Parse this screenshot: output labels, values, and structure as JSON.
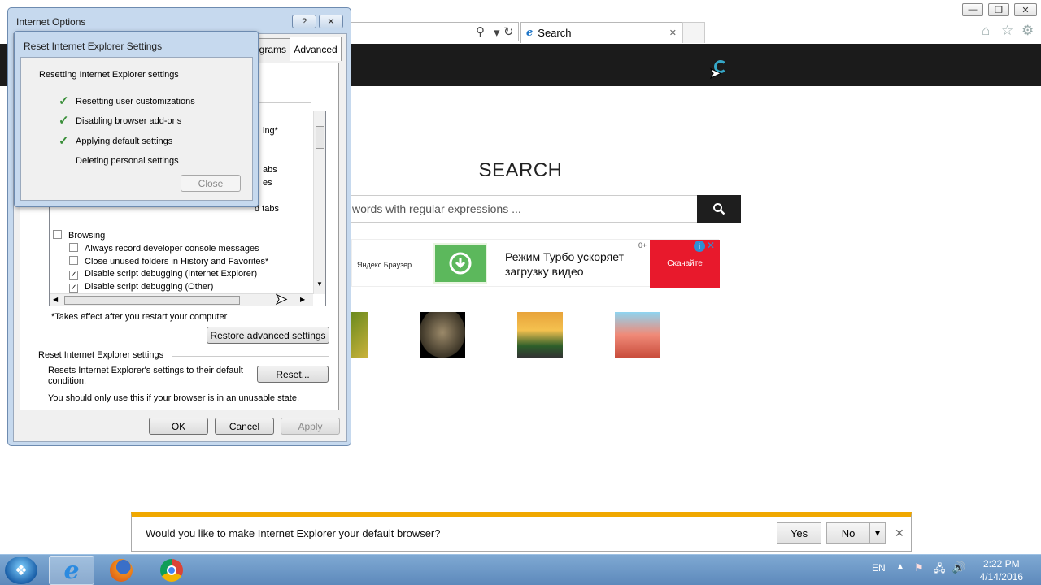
{
  "browser": {
    "tab_title": "Search",
    "tab_close": "✕",
    "window_controls": {
      "minimize": "—",
      "restore": "❐",
      "close": "✕"
    }
  },
  "page": {
    "search_heading": "SEARCH",
    "search_placeholder": "words with regular expressions ...",
    "ad": {
      "brand": "Яндекс.Браузер",
      "text": "Режим Турбо ускоряет загрузку видео",
      "cta": "Скачайте",
      "age": "0+",
      "info": "i",
      "close": "✕"
    }
  },
  "notification": {
    "message": "Would you like to make Internet Explorer your default browser?",
    "yes": "Yes",
    "no": "No",
    "dropdown": "▾",
    "close": "✕"
  },
  "internet_options": {
    "title": "Internet Options",
    "help": "?",
    "close": "✕",
    "tabs": {
      "programs": "grams",
      "advanced": "Advanced"
    },
    "partial_items": [
      "ing*",
      "abs",
      "es",
      "d tabs"
    ],
    "settings_items": [
      {
        "label": "Browsing",
        "checked": false
      },
      {
        "label": "Always record developer console messages",
        "checked": false
      },
      {
        "label": "Close unused folders in History and Favorites*",
        "checked": false
      },
      {
        "label": "Disable script debugging (Internet Explorer)",
        "checked": true
      },
      {
        "label": "Disable script debugging (Other)",
        "checked": true
      }
    ],
    "restart_note": "*Takes effect after you restart your computer",
    "restore_button": "Restore advanced settings",
    "reset_group": "Reset Internet Explorer settings",
    "reset_desc": "Resets Internet Explorer's settings to their default condition.",
    "reset_button": "Reset...",
    "unusable_note": "You should only use this if your browser is in an unusable state.",
    "ok": "OK",
    "cancel": "Cancel",
    "apply": "Apply"
  },
  "reset_dialog": {
    "title": "Reset Internet Explorer Settings",
    "heading": "Resetting Internet Explorer settings",
    "steps": [
      {
        "label": "Resetting user customizations",
        "done": true
      },
      {
        "label": "Disabling browser add-ons",
        "done": true
      },
      {
        "label": "Applying default settings",
        "done": true
      },
      {
        "label": "Deleting personal settings",
        "done": false
      }
    ],
    "tick": "✓",
    "close": "Close"
  },
  "taskbar": {
    "language": "EN",
    "time": "2:22 PM",
    "date": "4/14/2016"
  },
  "colors": {
    "accent_bar": "#f0a800",
    "page_header": "#1b1b1b",
    "ad_cta": "#e8192c",
    "ad_icon": "#5cb85c"
  }
}
